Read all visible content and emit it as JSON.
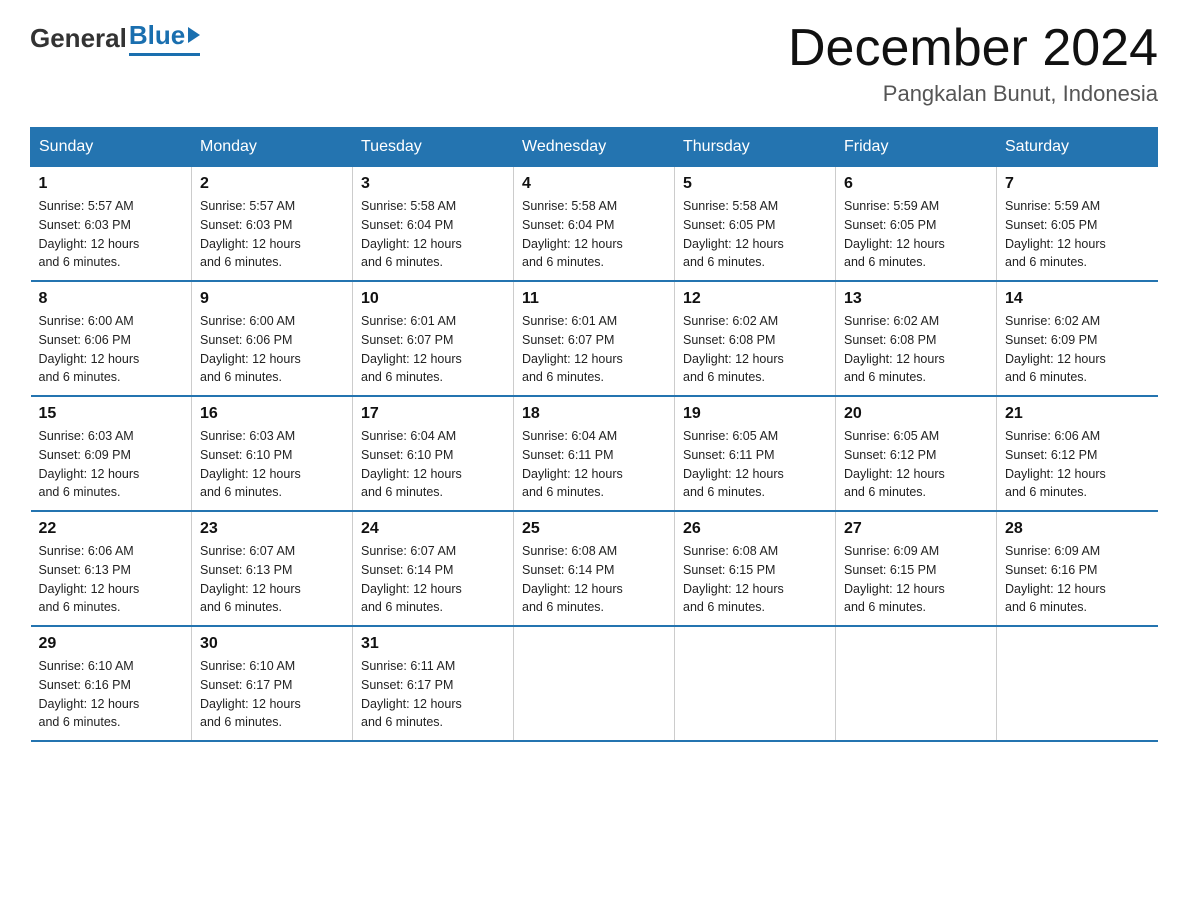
{
  "header": {
    "logo_general": "General",
    "logo_blue": "Blue",
    "month_title": "December 2024",
    "location": "Pangkalan Bunut, Indonesia"
  },
  "days_of_week": [
    "Sunday",
    "Monday",
    "Tuesday",
    "Wednesday",
    "Thursday",
    "Friday",
    "Saturday"
  ],
  "weeks": [
    [
      {
        "day": "1",
        "sunrise": "Sunrise: 5:57 AM",
        "sunset": "Sunset: 6:03 PM",
        "daylight": "Daylight: 12 hours and 6 minutes."
      },
      {
        "day": "2",
        "sunrise": "Sunrise: 5:57 AM",
        "sunset": "Sunset: 6:03 PM",
        "daylight": "Daylight: 12 hours and 6 minutes."
      },
      {
        "day": "3",
        "sunrise": "Sunrise: 5:58 AM",
        "sunset": "Sunset: 6:04 PM",
        "daylight": "Daylight: 12 hours and 6 minutes."
      },
      {
        "day": "4",
        "sunrise": "Sunrise: 5:58 AM",
        "sunset": "Sunset: 6:04 PM",
        "daylight": "Daylight: 12 hours and 6 minutes."
      },
      {
        "day": "5",
        "sunrise": "Sunrise: 5:58 AM",
        "sunset": "Sunset: 6:05 PM",
        "daylight": "Daylight: 12 hours and 6 minutes."
      },
      {
        "day": "6",
        "sunrise": "Sunrise: 5:59 AM",
        "sunset": "Sunset: 6:05 PM",
        "daylight": "Daylight: 12 hours and 6 minutes."
      },
      {
        "day": "7",
        "sunrise": "Sunrise: 5:59 AM",
        "sunset": "Sunset: 6:05 PM",
        "daylight": "Daylight: 12 hours and 6 minutes."
      }
    ],
    [
      {
        "day": "8",
        "sunrise": "Sunrise: 6:00 AM",
        "sunset": "Sunset: 6:06 PM",
        "daylight": "Daylight: 12 hours and 6 minutes."
      },
      {
        "day": "9",
        "sunrise": "Sunrise: 6:00 AM",
        "sunset": "Sunset: 6:06 PM",
        "daylight": "Daylight: 12 hours and 6 minutes."
      },
      {
        "day": "10",
        "sunrise": "Sunrise: 6:01 AM",
        "sunset": "Sunset: 6:07 PM",
        "daylight": "Daylight: 12 hours and 6 minutes."
      },
      {
        "day": "11",
        "sunrise": "Sunrise: 6:01 AM",
        "sunset": "Sunset: 6:07 PM",
        "daylight": "Daylight: 12 hours and 6 minutes."
      },
      {
        "day": "12",
        "sunrise": "Sunrise: 6:02 AM",
        "sunset": "Sunset: 6:08 PM",
        "daylight": "Daylight: 12 hours and 6 minutes."
      },
      {
        "day": "13",
        "sunrise": "Sunrise: 6:02 AM",
        "sunset": "Sunset: 6:08 PM",
        "daylight": "Daylight: 12 hours and 6 minutes."
      },
      {
        "day": "14",
        "sunrise": "Sunrise: 6:02 AM",
        "sunset": "Sunset: 6:09 PM",
        "daylight": "Daylight: 12 hours and 6 minutes."
      }
    ],
    [
      {
        "day": "15",
        "sunrise": "Sunrise: 6:03 AM",
        "sunset": "Sunset: 6:09 PM",
        "daylight": "Daylight: 12 hours and 6 minutes."
      },
      {
        "day": "16",
        "sunrise": "Sunrise: 6:03 AM",
        "sunset": "Sunset: 6:10 PM",
        "daylight": "Daylight: 12 hours and 6 minutes."
      },
      {
        "day": "17",
        "sunrise": "Sunrise: 6:04 AM",
        "sunset": "Sunset: 6:10 PM",
        "daylight": "Daylight: 12 hours and 6 minutes."
      },
      {
        "day": "18",
        "sunrise": "Sunrise: 6:04 AM",
        "sunset": "Sunset: 6:11 PM",
        "daylight": "Daylight: 12 hours and 6 minutes."
      },
      {
        "day": "19",
        "sunrise": "Sunrise: 6:05 AM",
        "sunset": "Sunset: 6:11 PM",
        "daylight": "Daylight: 12 hours and 6 minutes."
      },
      {
        "day": "20",
        "sunrise": "Sunrise: 6:05 AM",
        "sunset": "Sunset: 6:12 PM",
        "daylight": "Daylight: 12 hours and 6 minutes."
      },
      {
        "day": "21",
        "sunrise": "Sunrise: 6:06 AM",
        "sunset": "Sunset: 6:12 PM",
        "daylight": "Daylight: 12 hours and 6 minutes."
      }
    ],
    [
      {
        "day": "22",
        "sunrise": "Sunrise: 6:06 AM",
        "sunset": "Sunset: 6:13 PM",
        "daylight": "Daylight: 12 hours and 6 minutes."
      },
      {
        "day": "23",
        "sunrise": "Sunrise: 6:07 AM",
        "sunset": "Sunset: 6:13 PM",
        "daylight": "Daylight: 12 hours and 6 minutes."
      },
      {
        "day": "24",
        "sunrise": "Sunrise: 6:07 AM",
        "sunset": "Sunset: 6:14 PM",
        "daylight": "Daylight: 12 hours and 6 minutes."
      },
      {
        "day": "25",
        "sunrise": "Sunrise: 6:08 AM",
        "sunset": "Sunset: 6:14 PM",
        "daylight": "Daylight: 12 hours and 6 minutes."
      },
      {
        "day": "26",
        "sunrise": "Sunrise: 6:08 AM",
        "sunset": "Sunset: 6:15 PM",
        "daylight": "Daylight: 12 hours and 6 minutes."
      },
      {
        "day": "27",
        "sunrise": "Sunrise: 6:09 AM",
        "sunset": "Sunset: 6:15 PM",
        "daylight": "Daylight: 12 hours and 6 minutes."
      },
      {
        "day": "28",
        "sunrise": "Sunrise: 6:09 AM",
        "sunset": "Sunset: 6:16 PM",
        "daylight": "Daylight: 12 hours and 6 minutes."
      }
    ],
    [
      {
        "day": "29",
        "sunrise": "Sunrise: 6:10 AM",
        "sunset": "Sunset: 6:16 PM",
        "daylight": "Daylight: 12 hours and 6 minutes."
      },
      {
        "day": "30",
        "sunrise": "Sunrise: 6:10 AM",
        "sunset": "Sunset: 6:17 PM",
        "daylight": "Daylight: 12 hours and 6 minutes."
      },
      {
        "day": "31",
        "sunrise": "Sunrise: 6:11 AM",
        "sunset": "Sunset: 6:17 PM",
        "daylight": "Daylight: 12 hours and 6 minutes."
      },
      {
        "day": "",
        "sunrise": "",
        "sunset": "",
        "daylight": ""
      },
      {
        "day": "",
        "sunrise": "",
        "sunset": "",
        "daylight": ""
      },
      {
        "day": "",
        "sunrise": "",
        "sunset": "",
        "daylight": ""
      },
      {
        "day": "",
        "sunrise": "",
        "sunset": "",
        "daylight": ""
      }
    ]
  ]
}
